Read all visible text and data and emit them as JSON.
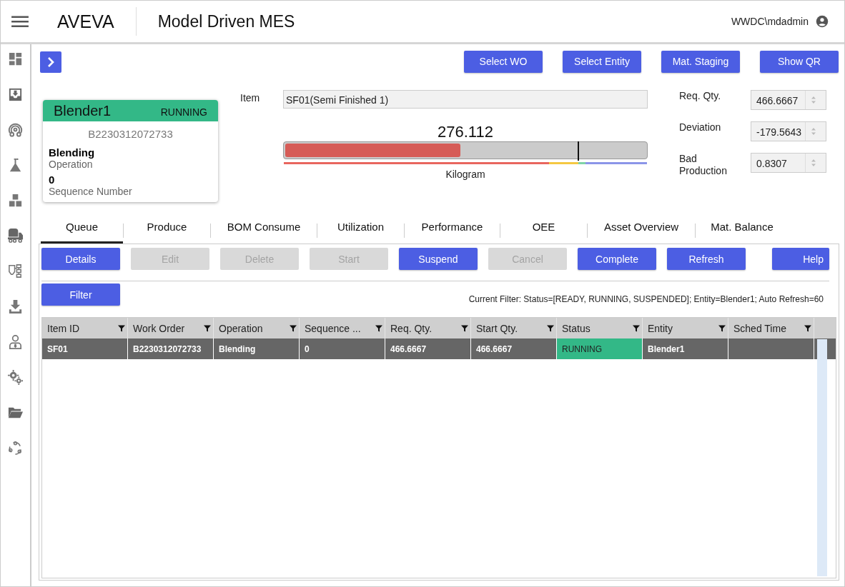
{
  "header": {
    "logo": "AVEVA",
    "title": "Model Driven MES",
    "user": "WWDC\\mdadmin"
  },
  "sidebar": {
    "items": [
      {
        "kind": "dashboard"
      },
      {
        "kind": "inbox"
      },
      {
        "kind": "gauge"
      },
      {
        "kind": "flask"
      },
      {
        "kind": "blocks"
      },
      {
        "kind": "truck"
      },
      {
        "kind": "process"
      },
      {
        "kind": "download"
      },
      {
        "kind": "person"
      },
      {
        "kind": "gears"
      },
      {
        "kind": "folder"
      },
      {
        "kind": "cycle"
      }
    ]
  },
  "top_buttons": [
    "Select WO",
    "Select Entity",
    "Mat. Staging",
    "Show QR"
  ],
  "entity_card": {
    "name": "Blender1",
    "state": "RUNNING",
    "color": "#33b887",
    "work_order": "B2230312072733",
    "operation": "Blending",
    "operation_label": "Operation",
    "sequence": "0",
    "sequence_label": "Sequence Number"
  },
  "item": {
    "label": "Item",
    "value": "SF01(Semi Finished 1)"
  },
  "gauge": {
    "reading": "276.112",
    "level": 0.49,
    "unit": "Kilogram",
    "target": {
      "level": 0.81
    }
  },
  "quantities": [
    {
      "label": "Req. Qty.",
      "value": "466.6667"
    },
    {
      "label": "Deviation",
      "value": "-179.5643"
    },
    {
      "label": "Bad Production",
      "value": "0.8307"
    }
  ],
  "tabs": [
    {
      "label": "Queue",
      "selected": true
    },
    {
      "label": "Produce",
      "selected": false
    },
    {
      "label": "BOM Consume",
      "selected": false
    },
    {
      "label": "Utilization",
      "selected": false
    },
    {
      "label": "Performance",
      "selected": false
    },
    {
      "label": "OEE",
      "selected": false
    },
    {
      "label": "Asset Overview",
      "selected": false
    },
    {
      "label": "Mat. Balance",
      "selected": false
    }
  ],
  "actions": [
    {
      "label": "Details",
      "disabled": false
    },
    {
      "label": "Edit",
      "disabled": true
    },
    {
      "label": "Delete",
      "disabled": true
    },
    {
      "label": "Start",
      "disabled": true
    },
    {
      "label": "Suspend",
      "disabled": false
    },
    {
      "label": "Cancel",
      "disabled": true
    },
    {
      "label": "Complete",
      "disabled": false
    },
    {
      "label": "Refresh",
      "disabled": false
    },
    {
      "label": "Help",
      "disabled": false
    }
  ],
  "filter_button": "Filter",
  "current_filter": "Current Filter: Status=[READY, RUNNING, SUSPENDED]; Entity=Blender1; Auto Refresh=60",
  "table": {
    "columns": [
      "Item ID",
      "Work Order",
      "Operation",
      "Sequence ...",
      "Req. Qty.",
      "Start Qty.",
      "Status",
      "Entity",
      "Sched Time"
    ],
    "rows": [
      {
        "selected": true,
        "cells": [
          {
            "text": "SF01"
          },
          {
            "text": "B2230312072733"
          },
          {
            "text": "Blending"
          },
          {
            "text": "0"
          },
          {
            "text": "466.6667"
          },
          {
            "text": "466.6667"
          },
          {
            "text": "RUNNING",
            "color": "#33b887"
          },
          {
            "text": "Blender1"
          }
        ]
      }
    ]
  }
}
